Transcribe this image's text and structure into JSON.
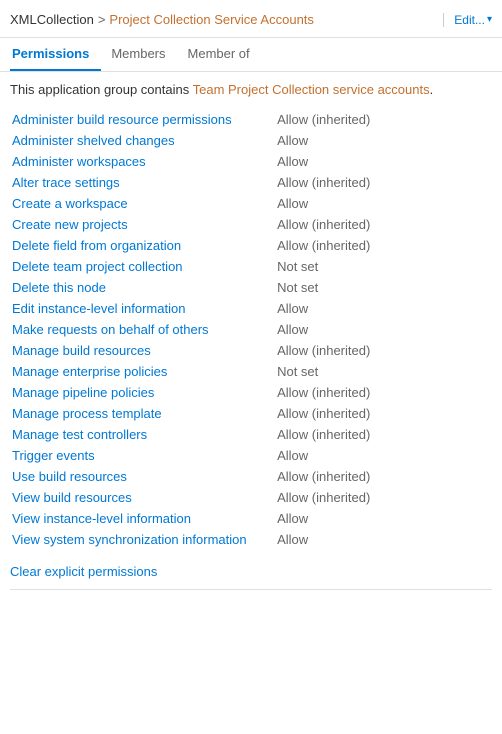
{
  "header": {
    "breadcrumb_link": "XMLCollection",
    "separator": ">",
    "current_page": "Project Collection Service Accounts",
    "action_label": "Edit...",
    "action_arrow": "▾"
  },
  "tabs": [
    {
      "label": "Permissions",
      "active": true
    },
    {
      "label": "Members",
      "active": false
    },
    {
      "label": "Member of",
      "active": false
    }
  ],
  "info": {
    "text_before": "This application group contains ",
    "highlight": "Team Project Collection service accounts",
    "text_after": "."
  },
  "permissions": [
    {
      "name": "Administer build resource permissions",
      "value": "Allow (inherited)",
      "type": "allow-inherited"
    },
    {
      "name": "Administer shelved changes",
      "value": "Allow",
      "type": "allow"
    },
    {
      "name": "Administer workspaces",
      "value": "Allow",
      "type": "allow"
    },
    {
      "name": "Alter trace settings",
      "value": "Allow (inherited)",
      "type": "allow-inherited"
    },
    {
      "name": "Create a workspace",
      "value": "Allow",
      "type": "allow"
    },
    {
      "name": "Create new projects",
      "value": "Allow (inherited)",
      "type": "allow-inherited"
    },
    {
      "name": "Delete field from organization",
      "value": "Allow (inherited)",
      "type": "allow-inherited"
    },
    {
      "name": "Delete team project collection",
      "value": "Not set",
      "type": "not-set"
    },
    {
      "name": "Delete this node",
      "value": "Not set",
      "type": "not-set"
    },
    {
      "name": "Edit instance-level information",
      "value": "Allow",
      "type": "allow"
    },
    {
      "name": "Make requests on behalf of others",
      "value": "Allow",
      "type": "allow"
    },
    {
      "name": "Manage build resources",
      "value": "Allow (inherited)",
      "type": "allow-inherited"
    },
    {
      "name": "Manage enterprise policies",
      "value": "Not set",
      "type": "not-set"
    },
    {
      "name": "Manage pipeline policies",
      "value": "Allow (inherited)",
      "type": "allow-inherited"
    },
    {
      "name": "Manage process template",
      "value": "Allow (inherited)",
      "type": "allow-inherited"
    },
    {
      "name": "Manage test controllers",
      "value": "Allow (inherited)",
      "type": "allow-inherited"
    },
    {
      "name": "Trigger events",
      "value": "Allow",
      "type": "allow"
    },
    {
      "name": "Use build resources",
      "value": "Allow (inherited)",
      "type": "allow-inherited"
    },
    {
      "name": "View build resources",
      "value": "Allow (inherited)",
      "type": "allow-inherited"
    },
    {
      "name": "View instance-level information",
      "value": "Allow",
      "type": "allow"
    },
    {
      "name": "View system synchronization information",
      "value": "Allow",
      "type": "allow"
    }
  ],
  "clear_link": "Clear explicit permissions"
}
